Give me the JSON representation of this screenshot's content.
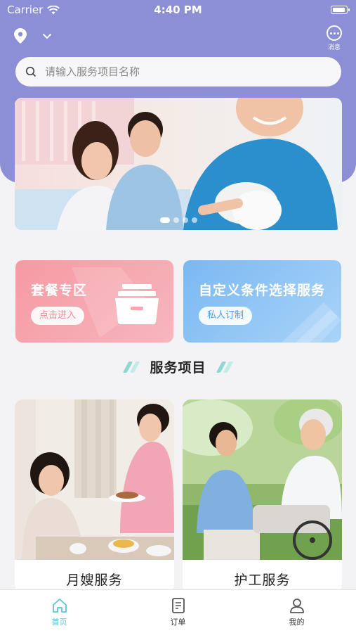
{
  "status": {
    "carrier": "Carrier",
    "time": "4:40 PM"
  },
  "header": {
    "message_label": "消息"
  },
  "search": {
    "placeholder": "请输入服务项目名称"
  },
  "banner": {
    "slides": 4,
    "active_index": 0
  },
  "cards": [
    {
      "title": "套餐专区",
      "button": "点击进入"
    },
    {
      "title": "自定义条件选择服务",
      "button": "私人订制"
    }
  ],
  "section": {
    "title": "服务项目"
  },
  "services": [
    {
      "label": "月嫂服务"
    },
    {
      "label": "护工服务"
    }
  ],
  "tabs": [
    {
      "label": "首页",
      "icon": "home-icon",
      "active": true
    },
    {
      "label": "订单",
      "icon": "order-icon",
      "active": false
    },
    {
      "label": "我的",
      "icon": "profile-icon",
      "active": false
    }
  ],
  "colors": {
    "header": "#8d8fd6",
    "accent": "#5fc3d7",
    "package_card": "#f59aa3",
    "custom_card": "#7ab8f2"
  }
}
